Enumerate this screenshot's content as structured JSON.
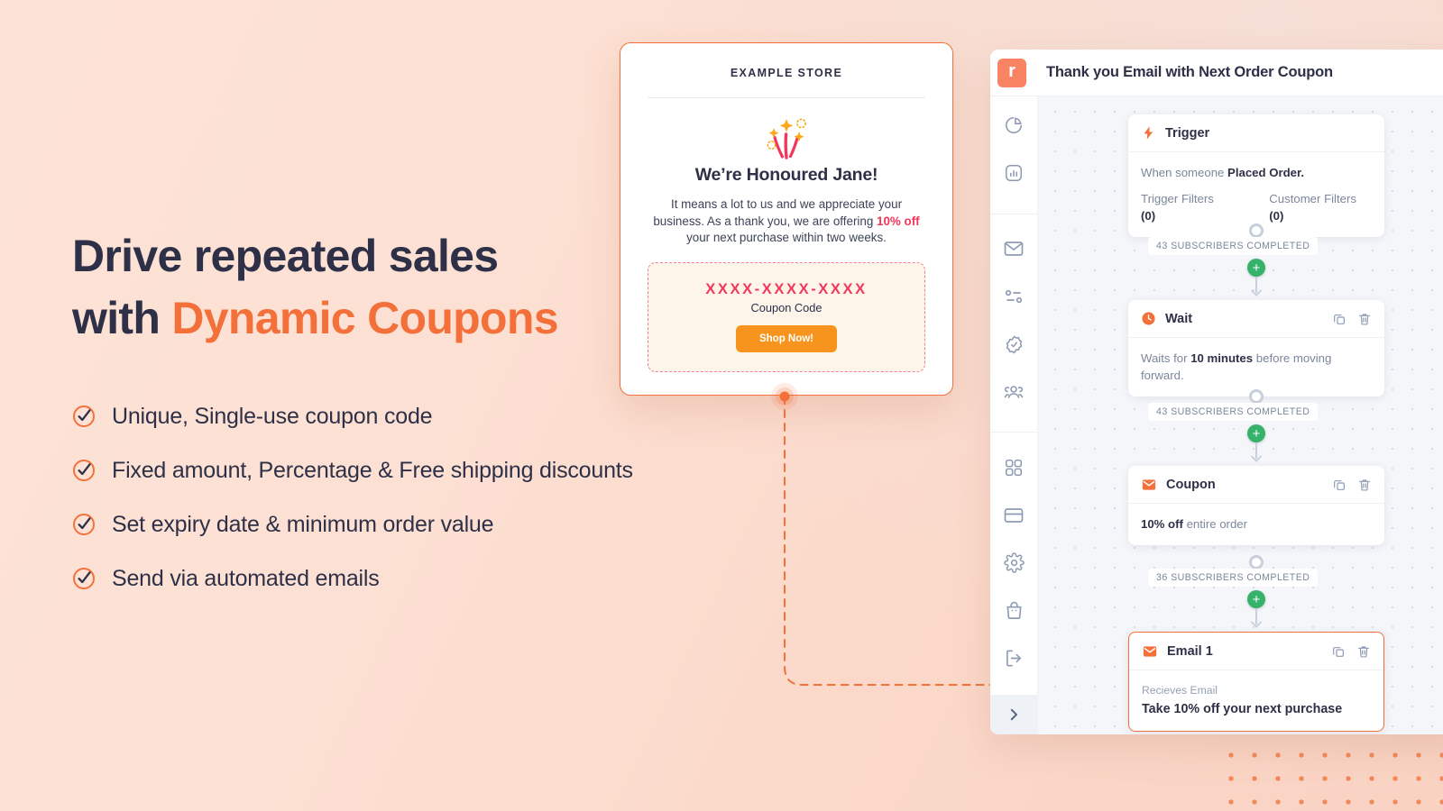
{
  "hero": {
    "headline_line1": "Drive repeated sales",
    "headline_line2_prefix": "with ",
    "headline_line2_accent": "Dynamic Coupons",
    "accent_color": "#f4703a",
    "text_color": "#2d3047",
    "features": [
      "Unique, Single-use coupon code",
      "Fixed amount, Percentage & Free shipping discounts",
      "Set expiry date & minimum order value",
      "Send via automated emails"
    ]
  },
  "email_preview": {
    "store_name": "EXAMPLE STORE",
    "illustration": "firework-icon",
    "greeting": "We’re Honoured Jane!",
    "body_part1": "It means a lot to us and we appreciate your business. As a thank you, we are offering ",
    "body_highlight": "10% off",
    "body_part2": " your next purchase within two weeks.",
    "coupon_code": "XXXX-XXXX-XXXX",
    "coupon_label": "Coupon Code",
    "cta_label": "Shop Now!",
    "highlight_color": "#f2385a",
    "cta_color": "#f7941d"
  },
  "app": {
    "logo_text": "r",
    "logo_color": "#f98463",
    "title": "Thank you Email with Next Order Coupon",
    "sidebar": [
      {
        "icon": "pie-chart-icon",
        "name": "dashboard"
      },
      {
        "icon": "bar-chart-icon",
        "name": "reports"
      },
      {
        "icon": "envelope-icon",
        "name": "campaigns"
      },
      {
        "icon": "automation-nodes-icon",
        "name": "automations"
      },
      {
        "icon": "badge-check-icon",
        "name": "coupons"
      },
      {
        "icon": "people-icon",
        "name": "audience"
      },
      {
        "icon": "grid-apps-icon",
        "name": "apps"
      },
      {
        "icon": "card-icon",
        "name": "billing"
      },
      {
        "icon": "gear-icon",
        "name": "settings"
      },
      {
        "icon": "bag-icon",
        "name": "store"
      },
      {
        "icon": "logout-icon",
        "name": "logout"
      }
    ],
    "expand_icon": "chevron-right-icon",
    "flow": {
      "nodes": [
        {
          "id": "trigger",
          "icon": "lightning-icon",
          "title": "Trigger",
          "line_prefix": "When someone ",
          "line_bold": "Placed Order.",
          "filters": [
            {
              "label": "Trigger Filters ",
              "count": "(0)"
            },
            {
              "label": "Customer Filters ",
              "count": "(0)"
            }
          ],
          "has_actions": false,
          "selected": false
        },
        {
          "id": "wait",
          "icon": "clock-icon",
          "title": "Wait",
          "body_prefix": "Waits for ",
          "body_bold": "10 minutes",
          "body_suffix": " before moving forward.",
          "has_actions": true,
          "selected": false
        },
        {
          "id": "coupon",
          "icon": "envelope-filled-icon",
          "title": "Coupon",
          "body_bold": "10% off",
          "body_suffix": " entire order",
          "has_actions": true,
          "selected": false
        },
        {
          "id": "email-1",
          "icon": "envelope-filled-icon",
          "title": "Email 1",
          "eyebrow": "Recieves Email",
          "subject": "Take 10% off your next purchase",
          "has_actions": true,
          "selected": true
        }
      ],
      "connectors": [
        {
          "label": "43 SUBSCRIBERS COMPLETED"
        },
        {
          "label": "43 SUBSCRIBERS COMPLETED"
        },
        {
          "label": "36 SUBSCRIBERS COMPLETED"
        }
      ],
      "add_step_label": "+",
      "add_step_color": "#37b26b",
      "duplicate_icon": "copy-icon",
      "delete_icon": "trash-icon"
    }
  }
}
